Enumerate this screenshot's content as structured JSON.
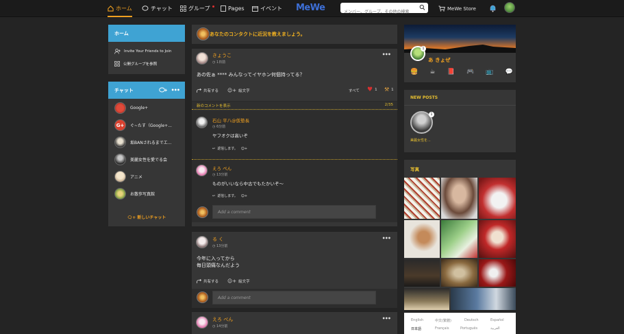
{
  "nav": {
    "home": "ホーム",
    "chat": "チャット",
    "groups": "グループ",
    "pages": "Pages",
    "events": "イベント",
    "logo": "MeWe",
    "search_placeholder": "メンバー、グループ、その他の検索",
    "store": "MeWe Store"
  },
  "sidebar": {
    "home_title": "ホーム",
    "home_items": [
      "Invite Your Friends to Join",
      "公開グループを参照"
    ],
    "chat_title": "チャット",
    "chats": [
      {
        "label": "Google+",
        "color": "#c0392b"
      },
      {
        "label": "ぐ~たす（Google+...",
        "color": "#d9412f"
      },
      {
        "label": "垢BANされるまでエ...",
        "color": "#2d2d2d"
      },
      {
        "label": "美麗女性を愛でる会",
        "color": "#555555"
      },
      {
        "label": "アニメ",
        "color": "#e8d9c0"
      },
      {
        "label": "お散歩写真館",
        "color": "#6d9a3d"
      }
    ],
    "new_chat": "新しいチャット"
  },
  "feed": {
    "banner": "あなたのコンタクトに近況を教えましょう。",
    "posts": [
      {
        "user": "きょうこ",
        "time": "1日前",
        "text": "あの佐ぁ **** みんなってイヤホン何個持ってる？",
        "share": "共有する",
        "emoji": "絵文字",
        "all": "すべて",
        "r1": "1",
        "r2": "1",
        "newc_label": "新のコメントを表示",
        "newc_count": "2/35",
        "comments": [
          {
            "user": "石山 平八@仮塾長",
            "time": "6分前",
            "text": "ヤフオクは高いぞ",
            "reply": "返信します。"
          },
          {
            "user": "えろ ぺん",
            "time": "13分前",
            "text": "ものがいいなら中古でもたかいぞ～",
            "reply": "返信します。"
          }
        ],
        "comment_placeholder": "Add a comment"
      },
      {
        "user": "る く",
        "time": "13分前",
        "text_lines": [
          "今年に入ってから",
          "毎日頭痛なんだよう"
        ],
        "share": "共有する",
        "emoji": "絵文字",
        "comment_placeholder": "Add a comment"
      },
      {
        "user": "えろ ぺん",
        "time": "14分前"
      }
    ]
  },
  "profile": {
    "name": "あ きょぜ",
    "badge": "1"
  },
  "newposts": {
    "title": "NEW POSTS",
    "item_label": "美麗女性を...",
    "badge": "1"
  },
  "photos": {
    "title": "写真"
  },
  "languages": {
    "row1": [
      "English",
      "中文(繁體)",
      "Deutsch",
      "Español"
    ],
    "row2": [
      "日本語",
      "Français",
      "Português",
      "العربية"
    ]
  },
  "colors": {
    "accent": "#f0a020",
    "header_blue": "#3fa3d3",
    "panel": "#363636",
    "bg": "#242424"
  }
}
